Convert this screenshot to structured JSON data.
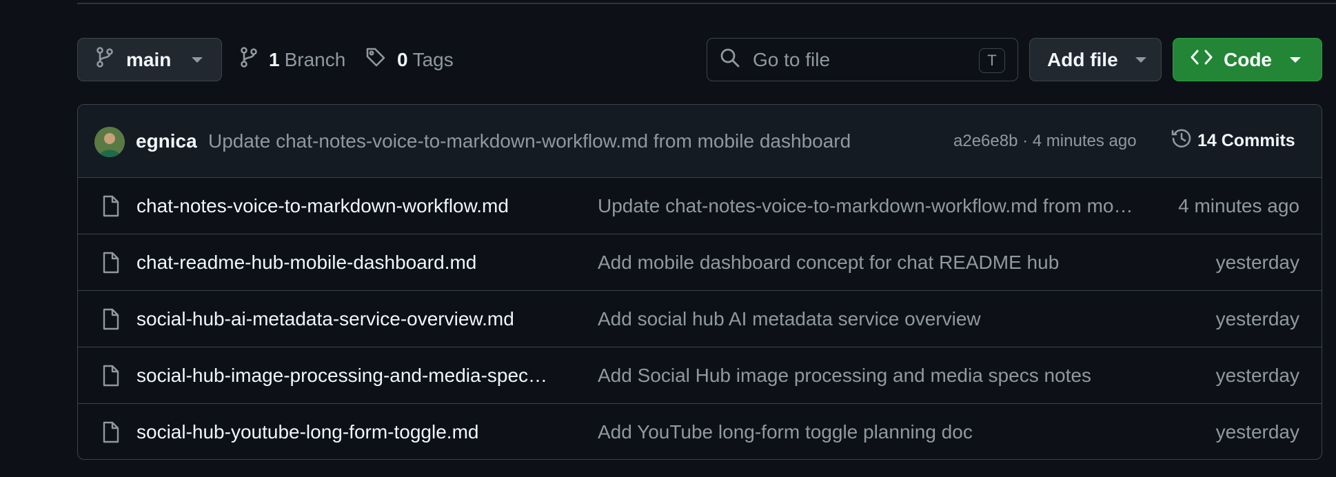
{
  "repo_toolbar": {
    "branch_selector": {
      "label": "main",
      "icon": "git-branch-icon"
    },
    "branches": {
      "count": "1",
      "label": "Branch",
      "icon": "git-branch-icon"
    },
    "tags": {
      "count": "0",
      "label": "Tags",
      "icon": "tag-icon"
    },
    "search": {
      "placeholder": "Go to file",
      "shortcut": "T",
      "icon": "search-icon"
    },
    "add_file": {
      "label": "Add file"
    },
    "code": {
      "label": "Code",
      "icon": "code-icon",
      "color": "#238636"
    }
  },
  "latest_commit": {
    "author": "egnica",
    "message": "Update chat-notes-voice-to-markdown-workflow.md from mobile dashboard",
    "hash": "a2e6e8b",
    "time": "4 minutes ago",
    "separator": "·",
    "commits_label": "14 Commits",
    "icon": "history-icon"
  },
  "files": [
    {
      "name": "chat-notes-voice-to-markdown-workflow.md",
      "message": "Update chat-notes-voice-to-markdown-workflow.md from mobile dashboard",
      "time": "4 minutes ago"
    },
    {
      "name": "chat-readme-hub-mobile-dashboard.md",
      "message": "Add mobile dashboard concept for chat README hub",
      "time": "yesterday"
    },
    {
      "name": "social-hub-ai-metadata-service-overview.md",
      "message": "Add social hub AI metadata service overview",
      "time": "yesterday"
    },
    {
      "name": "social-hub-image-processing-and-media-specs-notes.md",
      "message": "Add Social Hub image processing and media specs notes",
      "time": "yesterday"
    },
    {
      "name": "social-hub-youtube-long-form-toggle.md",
      "message": "Add YouTube long-form toggle planning doc",
      "time": "yesterday"
    }
  ]
}
